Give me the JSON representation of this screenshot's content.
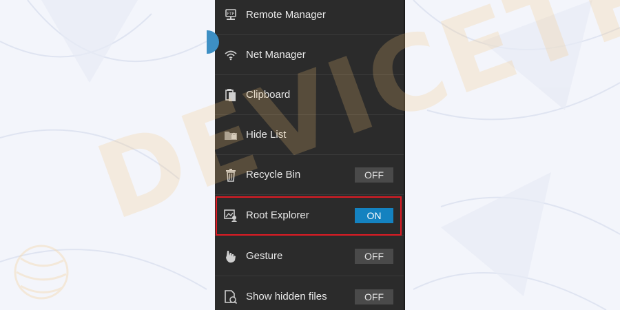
{
  "menu": {
    "items": [
      {
        "label": "Remote Manager",
        "icon": "remote-manager-icon",
        "toggle": null
      },
      {
        "label": "Net Manager",
        "icon": "wifi-icon",
        "toggle": null
      },
      {
        "label": "Clipboard",
        "icon": "clipboard-icon",
        "toggle": null
      },
      {
        "label": "Hide List",
        "icon": "hide-list-folder-icon",
        "toggle": null
      },
      {
        "label": "Recycle Bin",
        "icon": "trash-icon",
        "toggle": "OFF"
      },
      {
        "label": "Root Explorer",
        "icon": "root-explorer-icon",
        "toggle": "ON"
      },
      {
        "label": "Gesture",
        "icon": "gesture-hand-icon",
        "toggle": "OFF"
      },
      {
        "label": "Show hidden files",
        "icon": "hidden-files-icon",
        "toggle": "OFF"
      }
    ]
  },
  "watermark": {
    "text": "DEVICETRICKS"
  },
  "colors": {
    "panel": "#2b2b2b",
    "toggle_on": "#1482c0",
    "toggle_off": "#4a4a4a",
    "highlight": "#e01b24"
  }
}
